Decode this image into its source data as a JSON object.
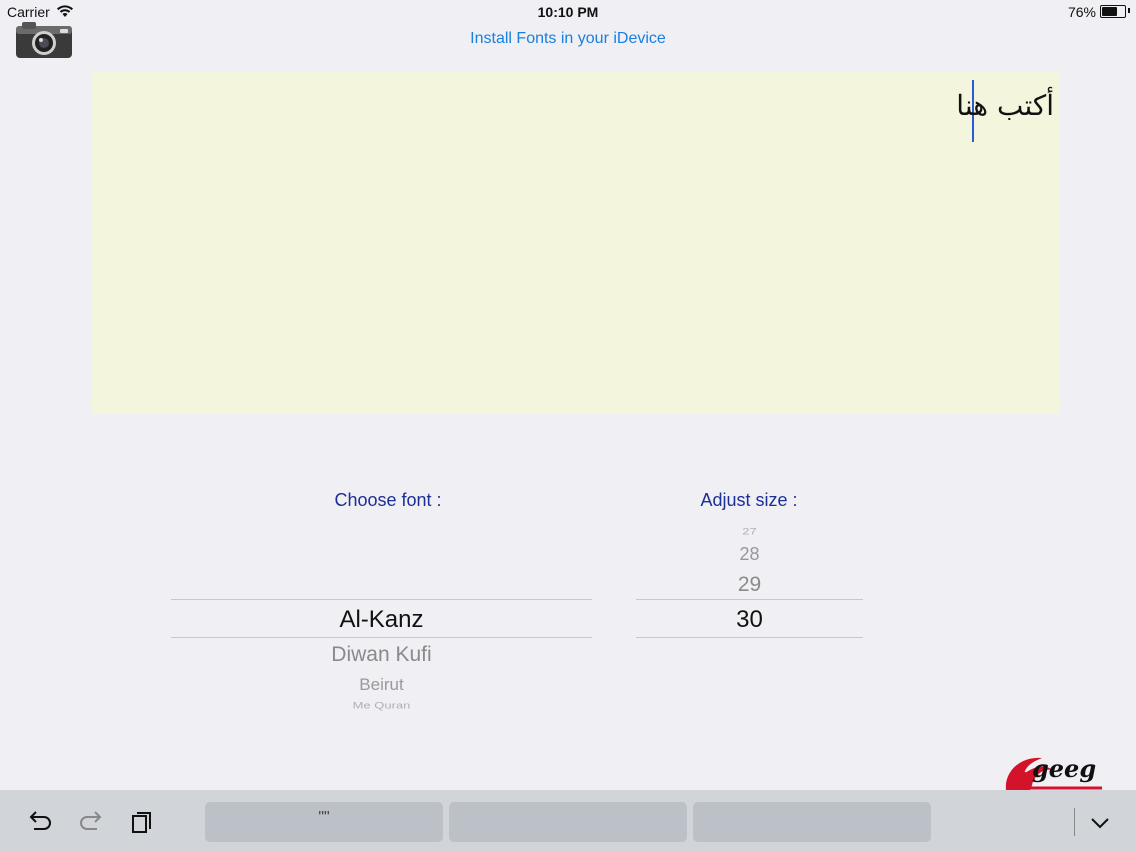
{
  "status_bar": {
    "carrier": "Carrier",
    "time": "10:10 PM",
    "battery_percent": "76%",
    "battery_level": 0.76
  },
  "header": {
    "install_link": "Install Fonts in your iDevice"
  },
  "editor": {
    "text": "أكتب هنا"
  },
  "font_picker": {
    "label": "Choose font :",
    "items": [
      "Al-Kanz",
      "Diwan Kufi",
      "Beirut",
      "Me Quran"
    ],
    "selected": "Al-Kanz"
  },
  "size_picker": {
    "label": "Adjust size :",
    "items": [
      "27",
      "28",
      "29",
      "30"
    ],
    "selected": "30"
  },
  "logo": {
    "text": "geeg"
  },
  "toolbar": {
    "suggestions": [
      "\"\"",
      "",
      ""
    ]
  },
  "colors": {
    "link": "#1a7fe0",
    "label": "#1c2f94",
    "editor_bg": "#f3f6dc",
    "caret": "#2b5bd7",
    "logo_red": "#d3132a"
  }
}
